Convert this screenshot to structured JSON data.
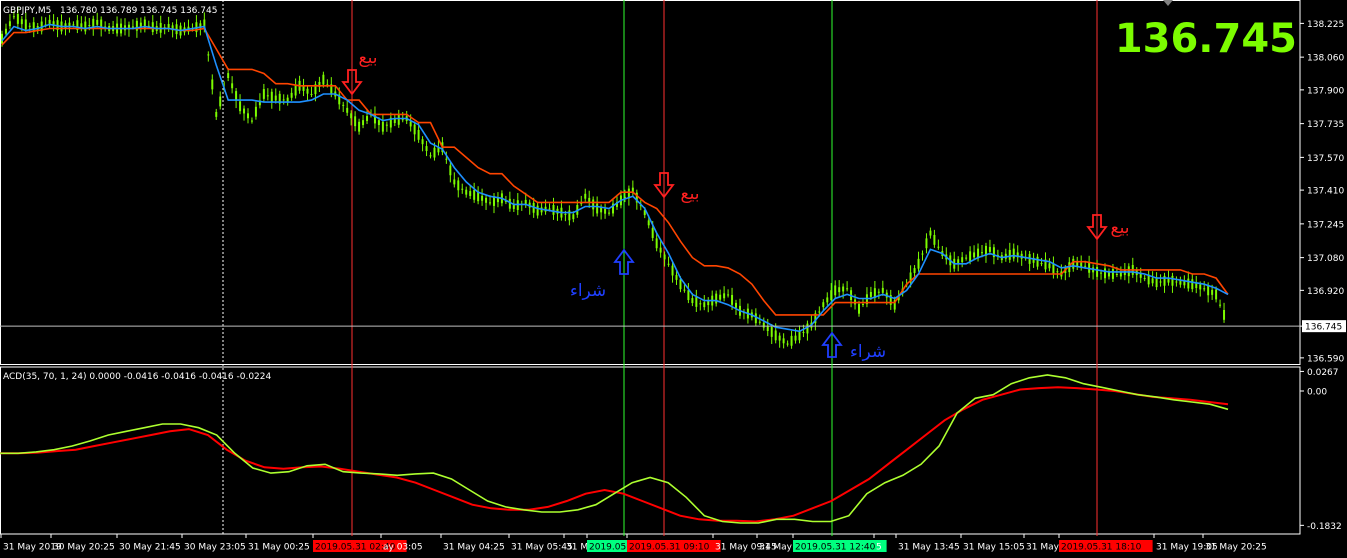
{
  "header": {
    "symbol": "GBPJPY,M5",
    "ohlc": "136.780 136.789 136.745 136.745",
    "big_price": "136.745"
  },
  "indicator": {
    "label": "ACD(35, 70, 1, 24) 0.0000 -0.0416 -0.0416 -0.0416 -0.0224"
  },
  "colors": {
    "candle": "#7cfc00",
    "fast_line": "#1e90ff",
    "slow_line": "#ff4500",
    "indicator_fast": "#adff2f",
    "indicator_slow": "#ff0000",
    "sell_line": "#ff3030",
    "buy_line": "#30ff30",
    "sell_text": "#ff2020",
    "buy_text": "#1f3fff",
    "big_price": "#7cfc00",
    "current_price_line": "#c0c0c0"
  },
  "chart_data": [
    {
      "type": "line",
      "title": "GBPJPY,M5",
      "xlabel": "",
      "ylabel": "",
      "x_ticks": [
        "31 May 2019",
        "30 May 20:25",
        "30 May 21:45",
        "30 May 23:05",
        "31 May 00:25",
        "2019.05.31 02:40",
        "ay 03:05",
        "31 May 04:25",
        "31 May 05:45",
        "31 M",
        "2019.05",
        "2019.05.31 09:10",
        "31 May 09:45",
        "31 May",
        "2019.05.31 12:40",
        "5",
        "31 May 13:45",
        "31 May 15:05",
        "31 May 16",
        "2019.05.31 18:10",
        "31 May 19:05",
        "31 May 20:25"
      ],
      "y_ticks": [
        "138.225",
        "138.060",
        "137.900",
        "137.735",
        "137.570",
        "137.410",
        "137.245",
        "137.080",
        "136.920",
        "136.745",
        "136.590"
      ],
      "ylim": [
        136.56,
        138.31
      ],
      "current_price": 136.745,
      "series": [
        {
          "values": [
            138.15,
            138.26,
            138.22,
            138.2,
            138.23,
            138.21,
            138.22,
            138.21,
            138.23,
            138.2,
            138.2,
            138.21,
            138.22,
            138.2,
            138.21,
            138.19,
            138.2,
            138.22,
            137.78,
            137.97,
            137.82,
            137.75,
            137.88,
            137.86,
            137.85,
            137.92,
            137.88,
            137.95,
            137.88,
            137.8,
            137.72,
            137.78,
            137.72,
            137.75,
            137.76,
            137.68,
            137.58,
            137.62,
            137.45,
            137.4,
            137.38,
            137.35,
            137.37,
            137.33,
            137.35,
            137.31,
            137.32,
            137.3,
            137.28,
            137.38,
            137.32,
            137.3,
            137.36,
            137.41,
            137.3,
            137.15,
            137.05,
            136.95,
            136.87,
            136.85,
            136.88,
            136.9,
            136.82,
            136.8,
            136.75,
            136.7,
            136.66,
            136.7,
            136.75,
            136.85,
            136.92,
            136.93,
            136.83,
            136.9,
            136.92,
            136.85,
            136.95,
            137.05,
            137.2,
            137.1,
            137.05,
            137.08,
            137.1,
            137.12,
            137.08,
            137.1,
            137.08,
            137.06,
            137.04,
            137.0,
            137.05,
            137.04,
            137.01,
            137.0,
            137.0,
            137.02,
            136.98,
            136.96,
            136.97,
            136.96,
            136.95,
            136.93,
            136.9,
            136.75
          ]
        },
        {
          "values": [
            138.14,
            138.21,
            138.19,
            138.2,
            138.22,
            138.21,
            138.21,
            138.2,
            138.21,
            138.2,
            138.2,
            138.2,
            138.21,
            138.2,
            138.2,
            138.19,
            138.2,
            138.21,
            138.02,
            137.85,
            137.85,
            137.85,
            137.84,
            137.84,
            137.84,
            137.84,
            137.85,
            137.88,
            137.88,
            137.85,
            137.8,
            137.78,
            137.75,
            137.76,
            137.76,
            137.73,
            137.64,
            137.61,
            137.52,
            137.45,
            137.4,
            137.38,
            137.37,
            137.34,
            137.34,
            137.32,
            137.31,
            137.3,
            137.3,
            137.33,
            137.33,
            137.32,
            137.36,
            137.38,
            137.32,
            137.2,
            137.1,
            136.98,
            136.9,
            136.87,
            136.87,
            136.85,
            136.82,
            136.8,
            136.77,
            136.74,
            136.73,
            136.72,
            136.75,
            136.82,
            136.88,
            136.9,
            136.88,
            136.88,
            136.9,
            136.88,
            136.92,
            137.0,
            137.12,
            137.1,
            137.05,
            137.05,
            137.08,
            137.1,
            137.08,
            137.09,
            137.08,
            137.07,
            137.06,
            137.03,
            137.04,
            137.03,
            137.02,
            137.01,
            137.01,
            137.01,
            137.0,
            136.98,
            136.98,
            136.97,
            136.96,
            136.95,
            136.93,
            136.9
          ]
        },
        {
          "values": [
            138.12,
            138.18,
            138.18,
            138.19,
            138.2,
            138.2,
            138.2,
            138.2,
            138.2,
            138.2,
            138.2,
            138.2,
            138.2,
            138.2,
            138.2,
            138.19,
            138.19,
            138.2,
            138.1,
            138.0,
            138.0,
            138.0,
            137.98,
            137.93,
            137.93,
            137.92,
            137.92,
            137.92,
            137.92,
            137.85,
            137.85,
            137.78,
            137.78,
            137.78,
            137.78,
            137.74,
            137.74,
            137.62,
            137.62,
            137.57,
            137.52,
            137.49,
            137.49,
            137.43,
            137.39,
            137.35,
            137.35,
            137.35,
            137.35,
            137.35,
            137.35,
            137.35,
            137.4,
            137.4,
            137.35,
            137.32,
            137.25,
            137.16,
            137.08,
            137.04,
            137.04,
            137.03,
            137.0,
            136.95,
            136.87,
            136.8,
            136.8,
            136.8,
            136.8,
            136.8,
            136.86,
            136.86,
            136.86,
            136.86,
            136.86,
            136.86,
            136.95,
            137.0,
            137.0,
            137.0,
            137.0,
            137.0,
            137.0,
            137.0,
            137.0,
            137.0,
            137.0,
            137.0,
            137.0,
            137.0,
            137.06,
            137.06,
            137.05,
            137.04,
            137.02,
            137.02,
            137.02,
            137.02,
            137.02,
            137.02,
            137.0,
            137.0,
            136.98,
            136.9
          ]
        }
      ]
    },
    {
      "type": "line",
      "title": "ACD(35, 70, 1, 24)",
      "xlabel": "",
      "ylabel": "",
      "y_ticks": [
        "0.0267",
        "0.00",
        "-0.1832"
      ],
      "ylim": [
        -0.195,
        0.03
      ],
      "series": [
        {
          "values": [
            -0.085,
            -0.085,
            -0.083,
            -0.08,
            -0.075,
            -0.068,
            -0.06,
            -0.055,
            -0.05,
            -0.045,
            -0.045,
            -0.05,
            -0.06,
            -0.085,
            -0.105,
            -0.112,
            -0.11,
            -0.102,
            -0.1,
            -0.11,
            -0.112,
            -0.113,
            -0.115,
            -0.113,
            -0.112,
            -0.12,
            -0.135,
            -0.15,
            -0.158,
            -0.162,
            -0.165,
            -0.165,
            -0.162,
            -0.155,
            -0.14,
            -0.125,
            -0.118,
            -0.125,
            -0.145,
            -0.17,
            -0.178,
            -0.18,
            -0.18,
            -0.175,
            -0.175,
            -0.178,
            -0.178,
            -0.17,
            -0.14,
            -0.125,
            -0.115,
            -0.1,
            -0.075,
            -0.03,
            -0.01,
            -0.005,
            0.01,
            0.018,
            0.022,
            0.018,
            0.01,
            0.005,
            0.0,
            -0.005,
            -0.008,
            -0.012,
            -0.015,
            -0.018,
            -0.025
          ]
        },
        {
          "values": [
            -0.085,
            -0.085,
            -0.084,
            -0.082,
            -0.08,
            -0.075,
            -0.07,
            -0.065,
            -0.06,
            -0.055,
            -0.052,
            -0.06,
            -0.08,
            -0.095,
            -0.104,
            -0.106,
            -0.104,
            -0.103,
            -0.106,
            -0.11,
            -0.114,
            -0.118,
            -0.125,
            -0.135,
            -0.145,
            -0.155,
            -0.16,
            -0.162,
            -0.162,
            -0.158,
            -0.15,
            -0.14,
            -0.135,
            -0.14,
            -0.15,
            -0.16,
            -0.17,
            -0.175,
            -0.177,
            -0.177,
            -0.178,
            -0.175,
            -0.17,
            -0.16,
            -0.15,
            -0.135,
            -0.12,
            -0.1,
            -0.08,
            -0.06,
            -0.04,
            -0.025,
            -0.012,
            -0.005,
            0.002,
            0.004,
            0.005,
            0.004,
            0.002,
            0.0,
            -0.004,
            -0.008,
            -0.01,
            -0.012,
            -0.015,
            -0.018
          ]
        }
      ]
    }
  ],
  "signals": [
    {
      "kind": "sell",
      "text": "بيع"
    },
    {
      "kind": "sell",
      "text": "بيع"
    },
    {
      "kind": "buy",
      "text": "شراء"
    },
    {
      "kind": "buy",
      "text": "شراء"
    },
    {
      "kind": "sell",
      "text": "بيع"
    }
  ],
  "x_tick_flags": [
    "",
    "",
    "",
    "",
    "",
    "sell",
    "",
    "",
    "",
    "",
    "buy",
    "sell",
    "",
    "",
    "buy",
    "",
    "",
    "",
    "",
    "sell",
    "",
    ""
  ]
}
